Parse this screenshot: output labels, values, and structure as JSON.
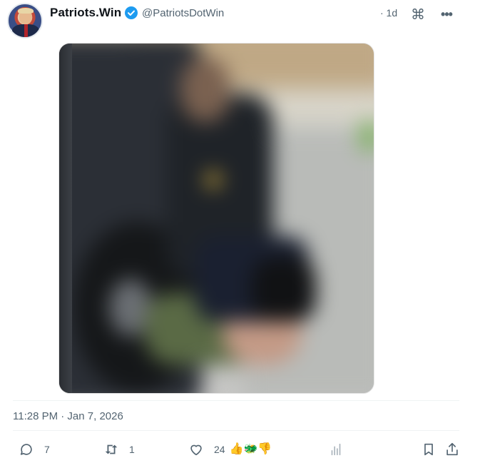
{
  "author": {
    "name": "Patriots.Win",
    "handle": "@PatriotsDotWin",
    "verified": true
  },
  "post": {
    "relative_time": "· 1d",
    "timestamp": "11:28 PM · Jan 7, 2026"
  },
  "header_icons": {
    "menu_icon": "command-icon",
    "more_icon": "more-horizontal-icon"
  },
  "actions": {
    "replies": "7",
    "reposts": "1",
    "likes": "24",
    "reactions": [
      "👍",
      "🐲",
      "👎"
    ]
  },
  "colors": {
    "accent": "#1d9bf0",
    "secondary_text": "#536471",
    "divider": "#eff3f4"
  }
}
